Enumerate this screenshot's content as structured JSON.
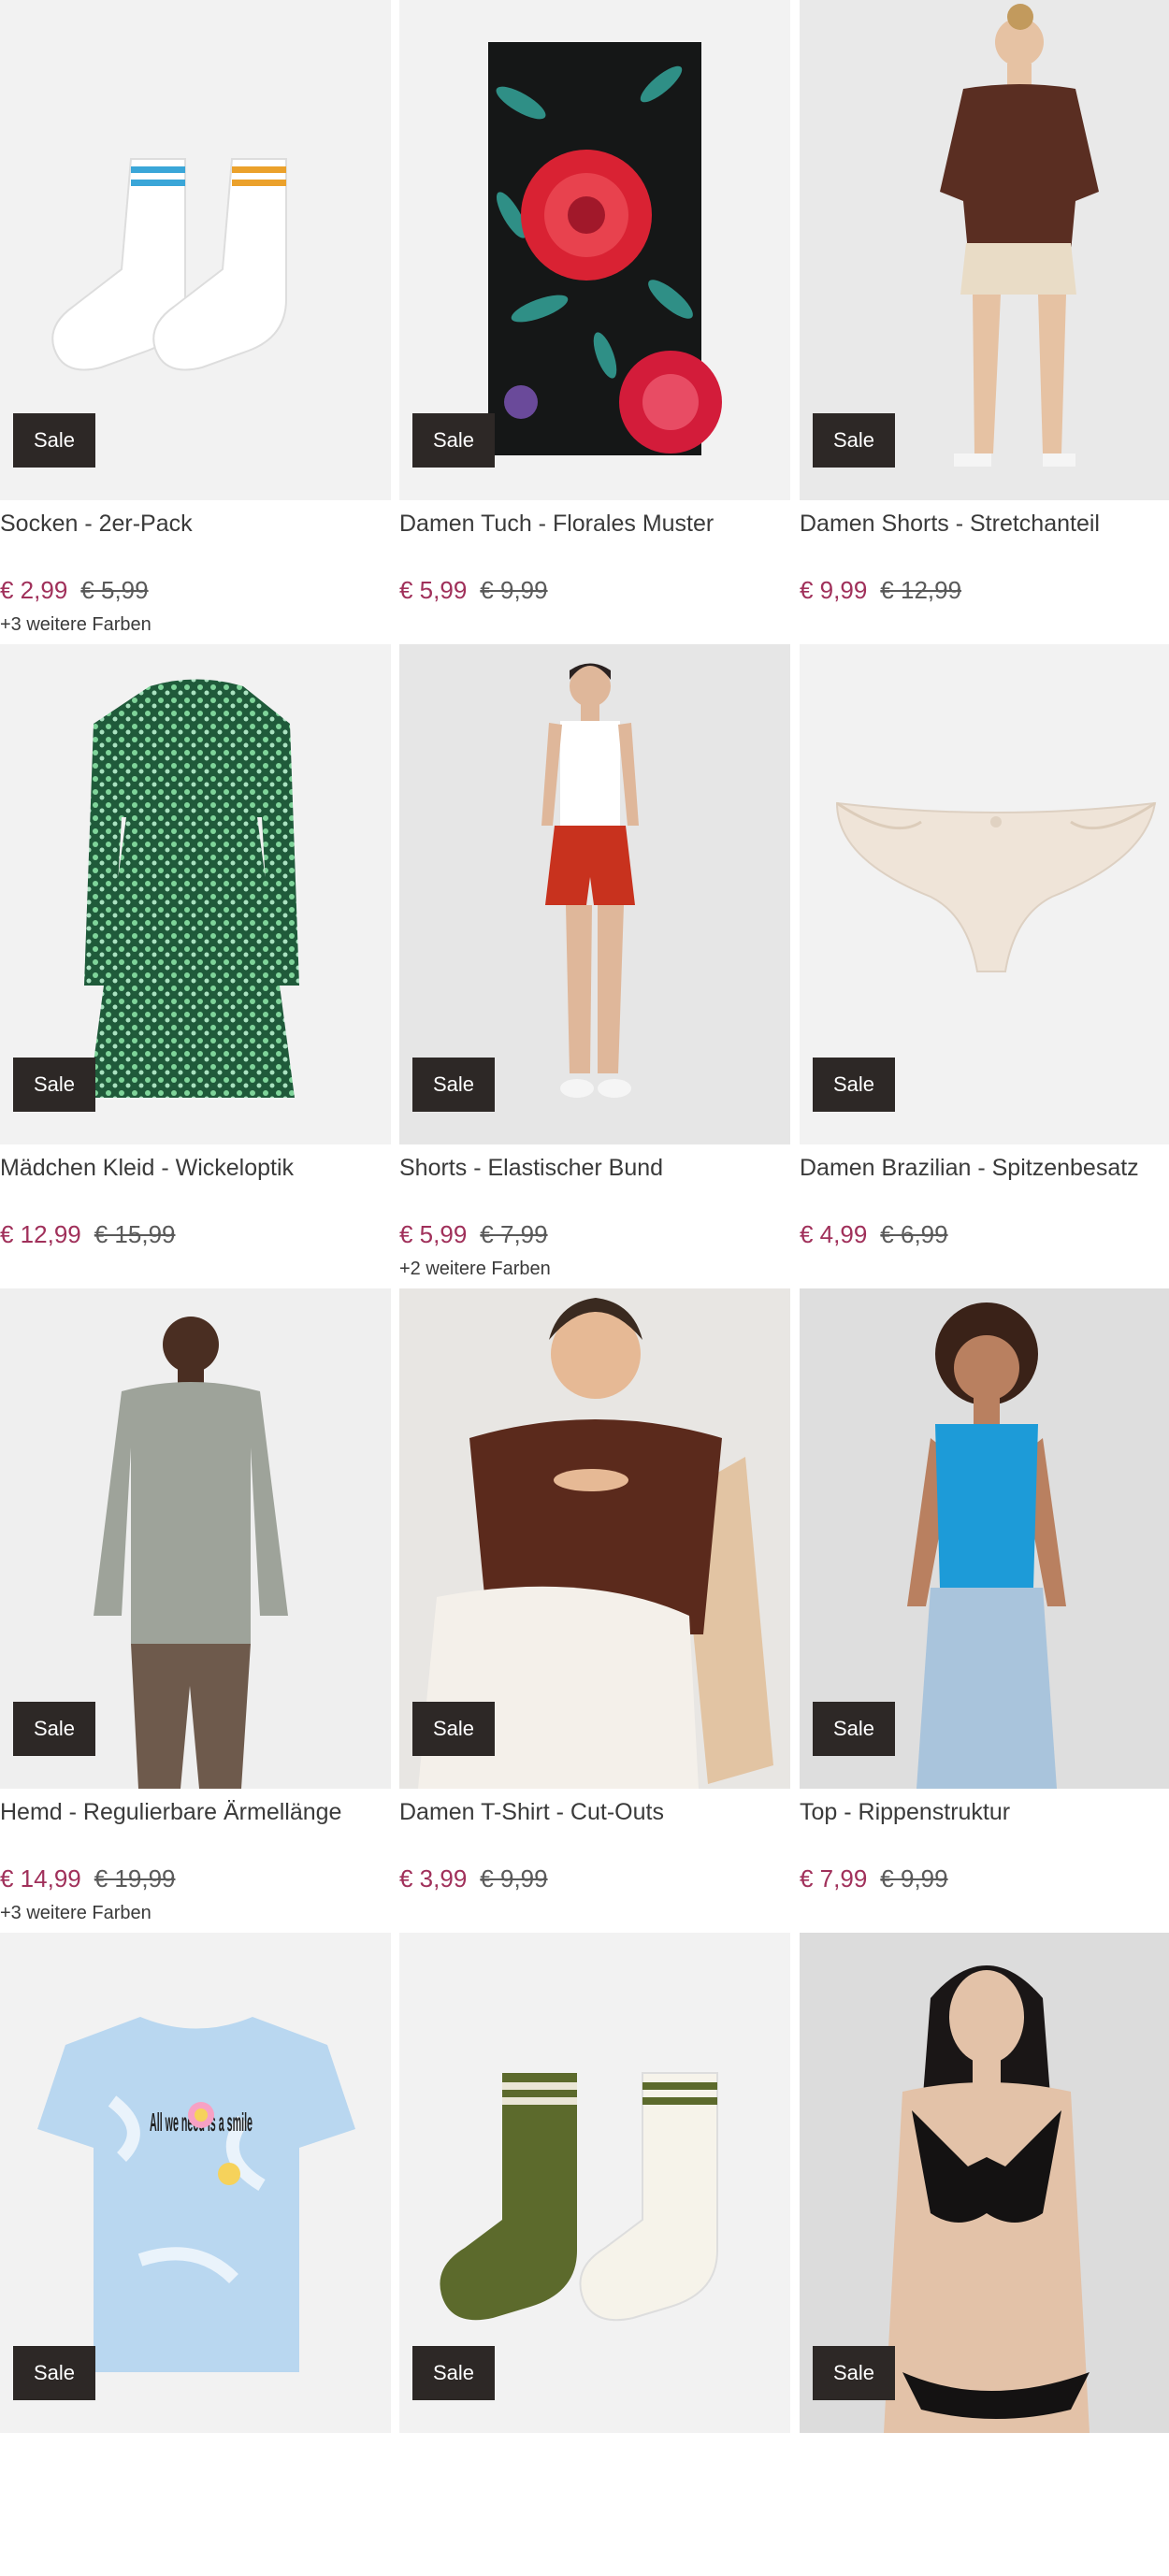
{
  "products": [
    {
      "title": "Socken - 2er-Pack",
      "price": "€ 2,99",
      "old_price": "€ 5,99",
      "badge": "Sale",
      "colors_note": "+3 weitere Farben",
      "image": "socks-white-icon"
    },
    {
      "title": "Damen Tuch - Florales Muster",
      "price": "€ 5,99",
      "old_price": "€ 9,99",
      "badge": "Sale",
      "colors_note": "",
      "image": "floral-scarf-icon"
    },
    {
      "title": "Damen Shorts - Stretchanteil",
      "price": "€ 9,99",
      "old_price": "€ 12,99",
      "badge": "Sale",
      "colors_note": "",
      "image": "model-shorts-icon"
    },
    {
      "title": "Mädchen Kleid - Wickeloptik",
      "price": "€ 12,99",
      "old_price": "€ 15,99",
      "badge": "Sale",
      "colors_note": "",
      "image": "green-dress-icon"
    },
    {
      "title": "Shorts - Elastischer Bund",
      "price": "€ 5,99",
      "old_price": "€ 7,99",
      "badge": "Sale",
      "colors_note": "+2 weitere Farben",
      "image": "model-red-shorts-icon"
    },
    {
      "title": "Damen Brazilian - Spitzenbesatz",
      "price": "€ 4,99",
      "old_price": "€ 6,99",
      "badge": "Sale",
      "colors_note": "",
      "image": "brazilian-brief-icon"
    },
    {
      "title": "Hemd - Regulierbare Ärmellänge",
      "price": "€ 14,99",
      "old_price": "€ 19,99",
      "badge": "Sale",
      "colors_note": "+3 weitere Farben",
      "image": "model-shirt-icon"
    },
    {
      "title": "Damen T-Shirt - Cut-Outs",
      "price": "€ 3,99",
      "old_price": "€ 9,99",
      "badge": "Sale",
      "colors_note": "",
      "image": "model-tshirt-icon"
    },
    {
      "title": "Top - Rippenstruktur",
      "price": "€ 7,99",
      "old_price": "€ 9,99",
      "badge": "Sale",
      "colors_note": "",
      "image": "model-blue-top-icon"
    },
    {
      "title": "",
      "price": "",
      "old_price": "",
      "badge": "Sale",
      "colors_note": "",
      "image": "kids-tshirt-icon",
      "print_text": "All we need is a smile"
    },
    {
      "title": "",
      "price": "",
      "old_price": "",
      "badge": "Sale",
      "colors_note": "",
      "image": "socks-olive-icon"
    },
    {
      "title": "",
      "price": "",
      "old_price": "",
      "badge": "Sale",
      "colors_note": "",
      "image": "model-bikini-icon"
    }
  ]
}
